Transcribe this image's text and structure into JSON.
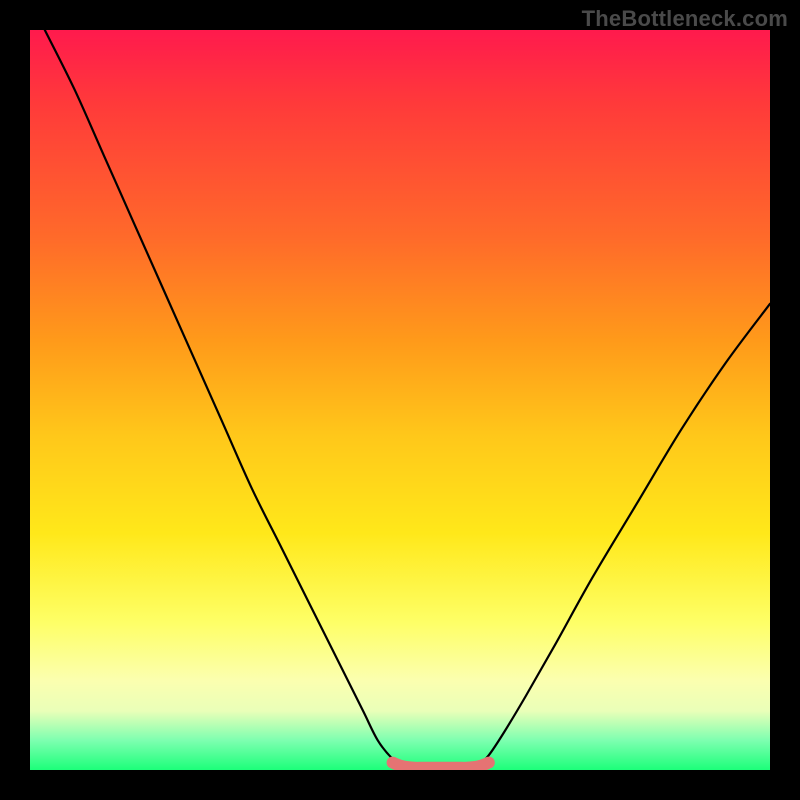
{
  "watermark": "TheBottleneck.com",
  "chart_data": {
    "type": "line",
    "title": "",
    "xlabel": "",
    "ylabel": "",
    "xlim": [
      0,
      100
    ],
    "ylim": [
      0,
      100
    ],
    "grid": false,
    "legend": false,
    "series": [
      {
        "name": "left-branch",
        "x": [
          2,
          6,
          10,
          14,
          18,
          22,
          26,
          30,
          34,
          38,
          42,
          45,
          47,
          49,
          50.5
        ],
        "values": [
          100,
          92,
          83,
          74,
          65,
          56,
          47,
          38,
          30,
          22,
          14,
          8,
          4,
          1.5,
          0.5
        ]
      },
      {
        "name": "right-branch",
        "x": [
          60.5,
          62,
          64,
          67,
          71,
          76,
          82,
          88,
          94,
          100
        ],
        "values": [
          0.5,
          2,
          5,
          10,
          17,
          26,
          36,
          46,
          55,
          63
        ]
      },
      {
        "name": "bottom-flat-highlight",
        "x": [
          49,
          50,
          51,
          52,
          53,
          54,
          55,
          56,
          57,
          58,
          59,
          60,
          61,
          62
        ],
        "values": [
          1.0,
          0.6,
          0.4,
          0.3,
          0.3,
          0.3,
          0.3,
          0.3,
          0.3,
          0.3,
          0.3,
          0.4,
          0.6,
          1.0
        ]
      }
    ]
  }
}
